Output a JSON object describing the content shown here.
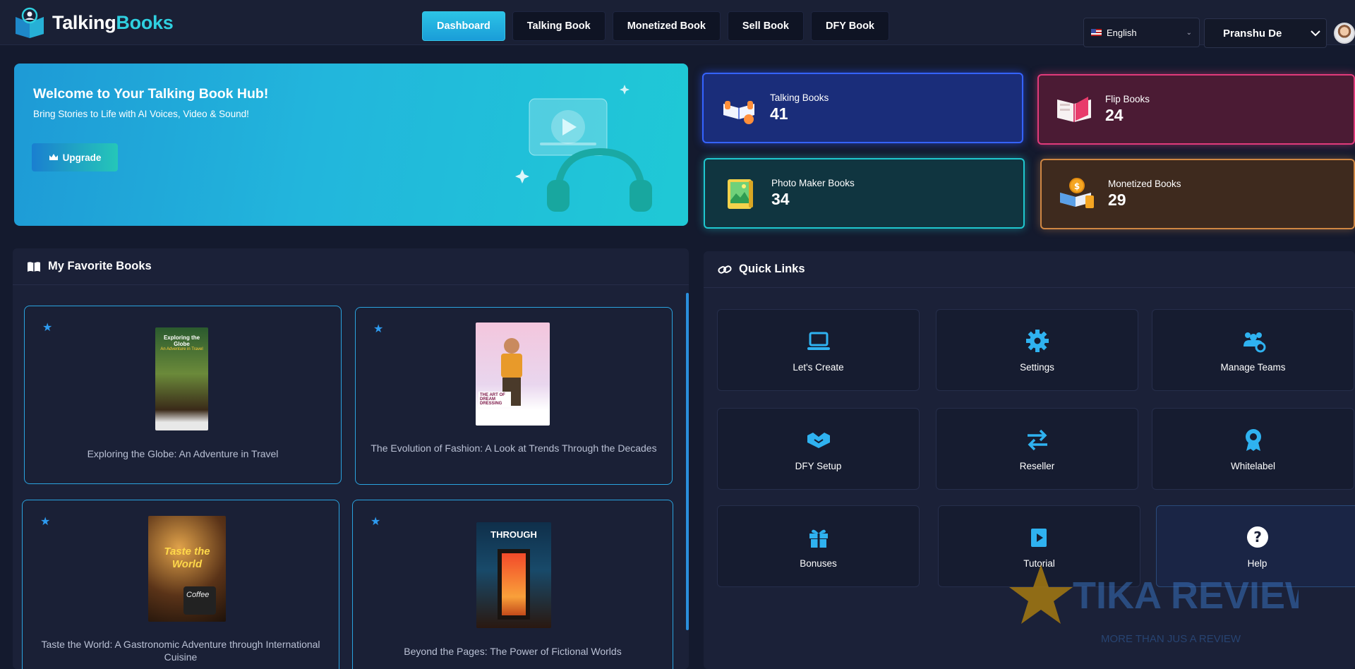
{
  "brand": {
    "name_a": "Talking",
    "name_b": "Books",
    "accent": "#2fd0e0"
  },
  "nav": [
    {
      "label": "Dashboard",
      "active": true
    },
    {
      "label": "Talking Book",
      "active": false
    },
    {
      "label": "Monetized Book",
      "active": false
    },
    {
      "label": "Sell Book",
      "active": false
    },
    {
      "label": "DFY Book",
      "active": false
    }
  ],
  "language": {
    "selected": "English",
    "icon": "us-flag-icon"
  },
  "user": {
    "name": "Pranshu De"
  },
  "hero": {
    "title": "Welcome to Your Talking Book Hub!",
    "subtitle": "Bring Stories to Life with AI Voices, Video & Sound!",
    "upgrade_label": "Upgrade",
    "upgrade_icon": "crown-icon"
  },
  "stats": [
    {
      "label": "Talking Books",
      "value": "41",
      "color": "#3563ff",
      "icon": "talking-book-icon"
    },
    {
      "label": "Flip Books",
      "value": "24",
      "color": "#e13a7b",
      "icon": "flip-book-icon"
    },
    {
      "label": "Photo Maker Books",
      "value": "34",
      "color": "#1fc7cf",
      "icon": "photo-book-icon"
    },
    {
      "label": "Monetized Books",
      "value": "29",
      "color": "#d08743",
      "icon": "monetized-book-icon"
    }
  ],
  "favorites": {
    "heading": "My Favorite Books",
    "books": [
      {
        "title": "Exploring the Globe: An Adventure in Travel",
        "cover_title": "Exploring the Globe",
        "cover_subtitle": "An Adventure in Travel"
      },
      {
        "title": "The Evolution of Fashion: A Look at Trends Through the Decades",
        "cover_title": "THE ART OF DREAM DRESSING"
      },
      {
        "title": "Taste the World: A Gastronomic Adventure through International Cuisine",
        "cover_title": "Taste the World",
        "cover_subtitle": "Coffee"
      },
      {
        "title": "Beyond the Pages: The Power of Fictional Worlds",
        "cover_title": "THROUGH"
      }
    ]
  },
  "quick_links": {
    "heading": "Quick Links",
    "items": [
      {
        "label": "Let's Create",
        "icon": "laptop-icon"
      },
      {
        "label": "Settings",
        "icon": "gear-icon"
      },
      {
        "label": "Manage Teams",
        "icon": "users-gear-icon"
      },
      {
        "label": "DFY Setup",
        "icon": "handshake-icon"
      },
      {
        "label": "Reseller",
        "icon": "exchange-arrows-icon"
      },
      {
        "label": "Whitelabel",
        "icon": "award-icon"
      },
      {
        "label": "Bonuses",
        "icon": "gift-icon"
      },
      {
        "label": "Tutorial",
        "icon": "video-icon"
      },
      {
        "label": "Help",
        "icon": "question-icon"
      }
    ]
  },
  "watermark": {
    "title": "TIKA REVIEW",
    "tagline": "MORE THAN JUS A REVIEW"
  }
}
